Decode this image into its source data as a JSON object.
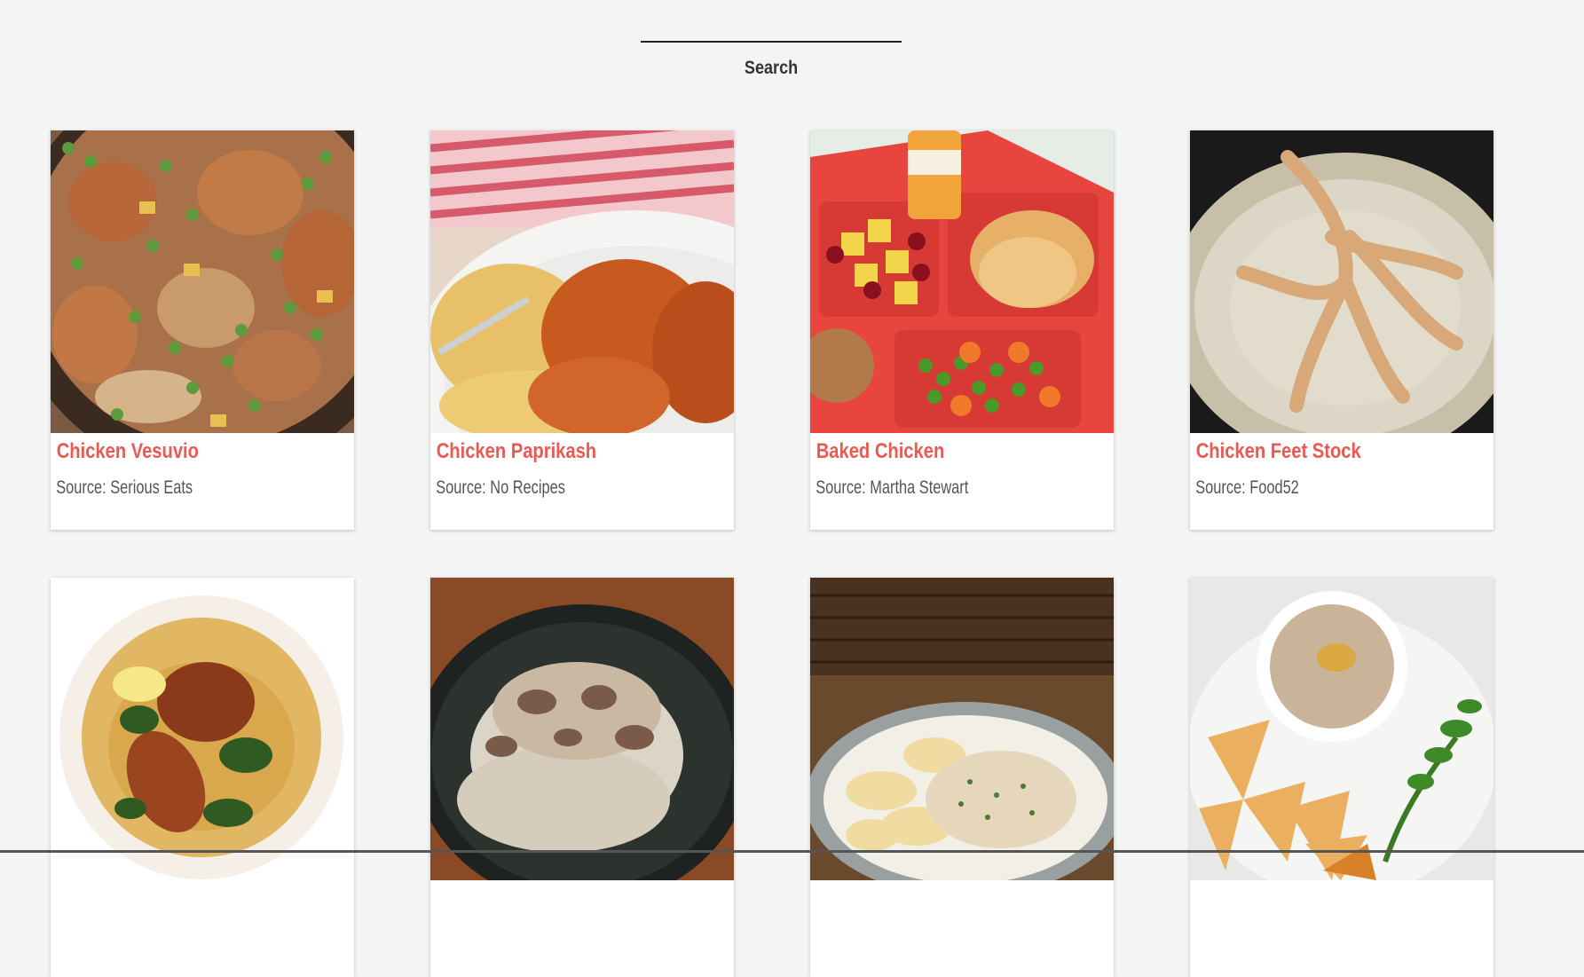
{
  "search": {
    "button_label": "Search",
    "input_value": ""
  },
  "recipes": [
    {
      "title": "Chicken Vesuvio",
      "source": "Source: Serious Eats",
      "image": "chicken-vesuvio-photo"
    },
    {
      "title": "Chicken Paprikash",
      "source": "Source: No Recipes",
      "image": "chicken-paprikash-photo"
    },
    {
      "title": "Baked Chicken",
      "source": "Source: Martha Stewart",
      "image": "baked-chicken-tray-photo"
    },
    {
      "title": "Chicken Feet Stock",
      "source": "Source: Food52",
      "image": "chicken-feet-photo"
    },
    {
      "title": "",
      "source": "",
      "image": "chicken-broth-bowl-photo"
    },
    {
      "title": "",
      "source": "",
      "image": "chicken-rice-photo"
    },
    {
      "title": "",
      "source": "",
      "image": "chicken-noodles-photo"
    },
    {
      "title": "",
      "source": "",
      "image": "dip-and-chips-photo"
    }
  ],
  "colors": {
    "title": "#e85a52",
    "background": "#f4f4f4",
    "card": "#ffffff"
  }
}
